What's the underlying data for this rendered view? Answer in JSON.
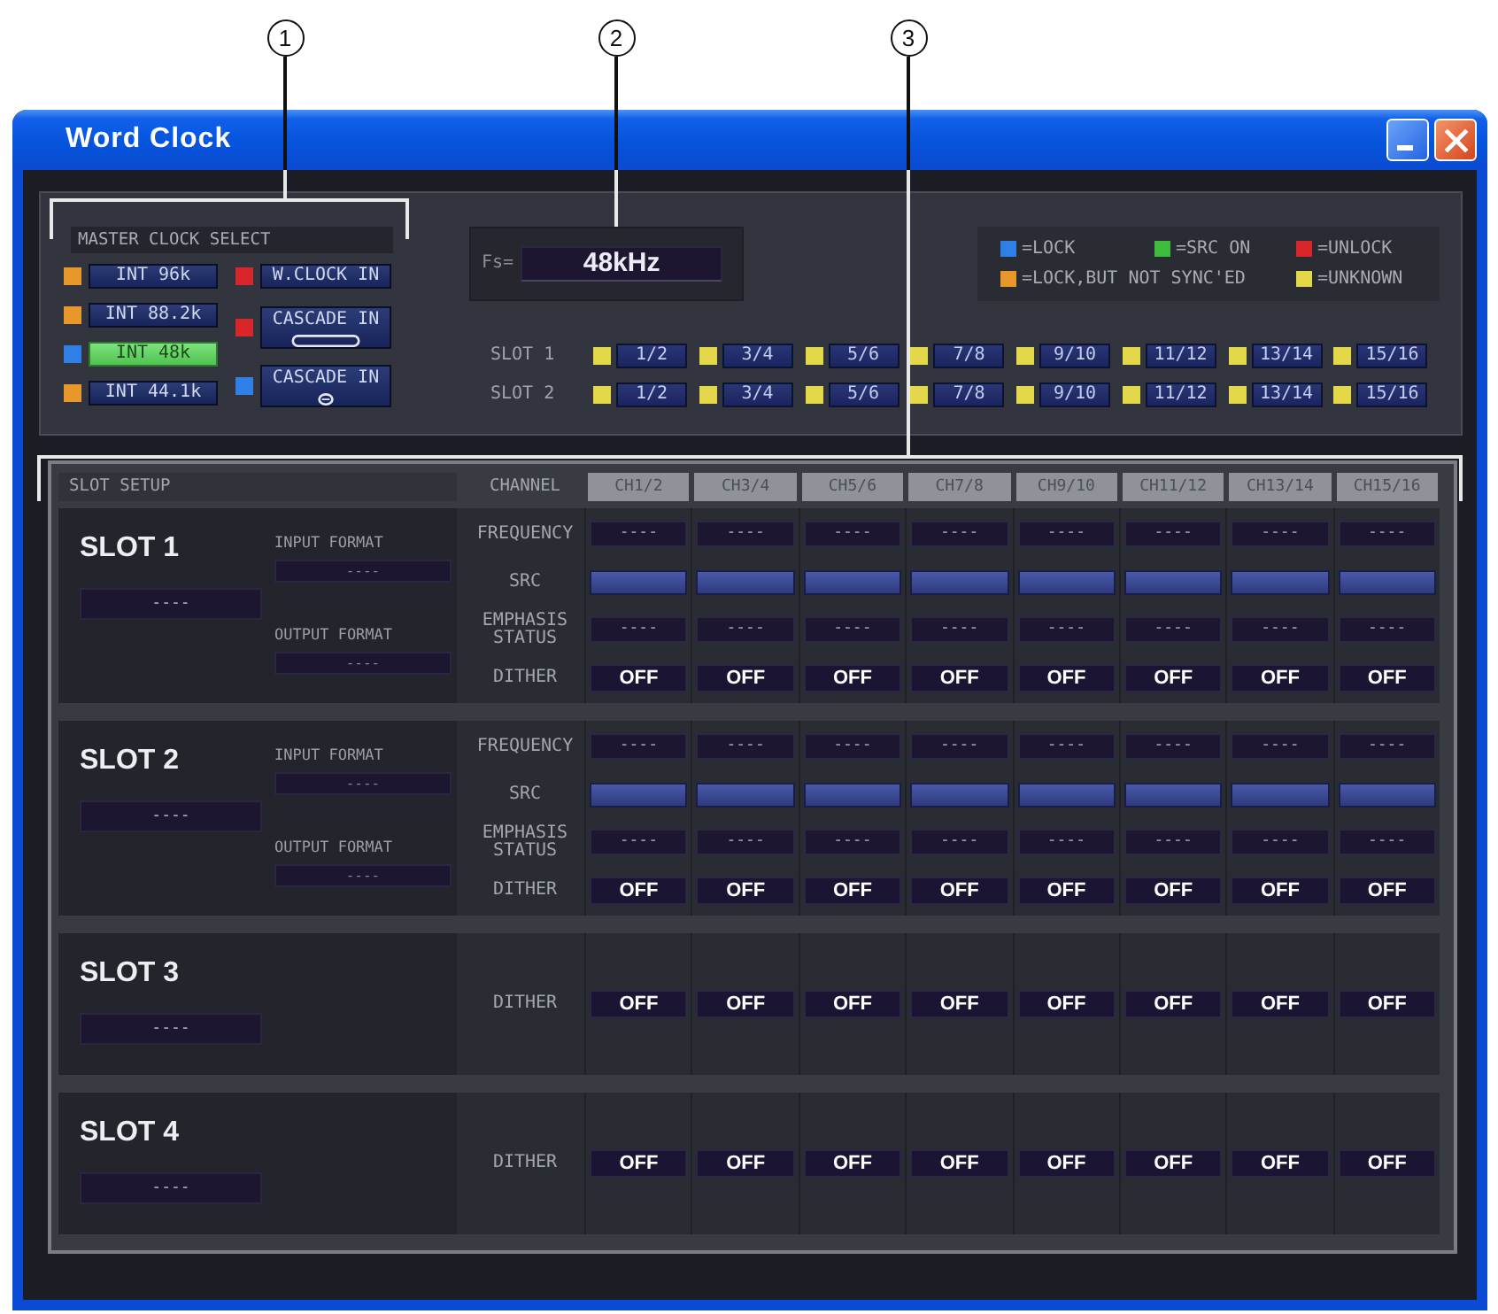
{
  "callouts": [
    {
      "number": "1"
    },
    {
      "number": "2"
    },
    {
      "number": "3"
    }
  ],
  "window": {
    "title": "Word Clock"
  },
  "master_clock_select": {
    "title": "MASTER CLOCK SELECT",
    "internal": [
      {
        "label": "INT 96k",
        "color": "#e8982a",
        "selected": false
      },
      {
        "label": "INT 88.2k",
        "color": "#e8982a",
        "selected": false
      },
      {
        "label": "INT 48k",
        "color": "#2f7fe6",
        "selected": true
      },
      {
        "label": "INT 44.1k",
        "color": "#e8982a",
        "selected": false
      }
    ],
    "external": [
      {
        "label": "W.CLOCK IN",
        "color": "#d8262a",
        "selected": false,
        "kind": "plain"
      },
      {
        "label": "CASCADE IN",
        "color": "#d8262a",
        "selected": false,
        "kind": "oval-connector"
      },
      {
        "label": "CASCADE IN",
        "color": "#2f7fe6",
        "selected": false,
        "kind": "round-connector"
      }
    ]
  },
  "fs": {
    "label": "Fs=",
    "value": "48kHz"
  },
  "legend": [
    {
      "color": "#2f7fe6",
      "label": "=LOCK"
    },
    {
      "color": "#3dbb3d",
      "label": "=SRC ON"
    },
    {
      "color": "#d8262a",
      "label": "=UNLOCK"
    },
    {
      "color": "#e8982a",
      "label": "=LOCK,BUT NOT SYNC'ED"
    },
    {
      "color": "#e2d84a",
      "label": "=UNKNOWN"
    }
  ],
  "slot_status": [
    {
      "label": "SLOT 1",
      "channels": [
        {
          "label": "1/2",
          "color": "#e2d84a"
        },
        {
          "label": "3/4",
          "color": "#e2d84a"
        },
        {
          "label": "5/6",
          "color": "#e2d84a"
        },
        {
          "label": "7/8",
          "color": "#e2d84a"
        },
        {
          "label": "9/10",
          "color": "#e2d84a"
        },
        {
          "label": "11/12",
          "color": "#e2d84a"
        },
        {
          "label": "13/14",
          "color": "#e2d84a"
        },
        {
          "label": "15/16",
          "color": "#e2d84a"
        }
      ]
    },
    {
      "label": "SLOT 2",
      "channels": [
        {
          "label": "1/2",
          "color": "#e2d84a"
        },
        {
          "label": "3/4",
          "color": "#e2d84a"
        },
        {
          "label": "5/6",
          "color": "#e2d84a"
        },
        {
          "label": "7/8",
          "color": "#e2d84a"
        },
        {
          "label": "9/10",
          "color": "#e2d84a"
        },
        {
          "label": "11/12",
          "color": "#e2d84a"
        },
        {
          "label": "13/14",
          "color": "#e2d84a"
        },
        {
          "label": "15/16",
          "color": "#e2d84a"
        }
      ]
    }
  ],
  "slot_setup": {
    "title": "SLOT SETUP",
    "channel_label": "CHANNEL",
    "channels": [
      "CH1/2",
      "CH3/4",
      "CH5/6",
      "CH7/8",
      "CH9/10",
      "CH11/12",
      "CH13/14",
      "CH15/16"
    ],
    "slots": [
      {
        "name": "SLOT 1",
        "card": "----",
        "input_format": {
          "label": "INPUT FORMAT",
          "value": "----"
        },
        "output_format": {
          "label": "OUTPUT FORMAT",
          "value": "----"
        },
        "rows": [
          {
            "label": "FREQUENCY",
            "kind": "readout",
            "cells": [
              "----",
              "----",
              "----",
              "----",
              "----",
              "----",
              "----",
              "----"
            ]
          },
          {
            "label": "SRC",
            "kind": "switch",
            "cells": [
              {
                "on": false
              },
              {
                "on": false
              },
              {
                "on": false
              },
              {
                "on": false
              },
              {
                "on": false
              },
              {
                "on": false
              },
              {
                "on": false
              },
              {
                "on": false
              }
            ]
          },
          {
            "label": "EMPHASIS STATUS",
            "kind": "readout",
            "cells": [
              "----",
              "----",
              "----",
              "----",
              "----",
              "----",
              "----",
              "----"
            ]
          },
          {
            "label": "DITHER",
            "kind": "setting",
            "cells": [
              "OFF",
              "OFF",
              "OFF",
              "OFF",
              "OFF",
              "OFF",
              "OFF",
              "OFF"
            ]
          }
        ]
      },
      {
        "name": "SLOT 2",
        "card": "----",
        "input_format": {
          "label": "INPUT FORMAT",
          "value": "----"
        },
        "output_format": {
          "label": "OUTPUT FORMAT",
          "value": "----"
        },
        "rows": [
          {
            "label": "FREQUENCY",
            "kind": "readout",
            "cells": [
              "----",
              "----",
              "----",
              "----",
              "----",
              "----",
              "----",
              "----"
            ]
          },
          {
            "label": "SRC",
            "kind": "switch",
            "cells": [
              {
                "on": false
              },
              {
                "on": false
              },
              {
                "on": false
              },
              {
                "on": false
              },
              {
                "on": false
              },
              {
                "on": false
              },
              {
                "on": false
              },
              {
                "on": false
              }
            ]
          },
          {
            "label": "EMPHASIS STATUS",
            "kind": "readout",
            "cells": [
              "----",
              "----",
              "----",
              "----",
              "----",
              "----",
              "----",
              "----"
            ]
          },
          {
            "label": "DITHER",
            "kind": "setting",
            "cells": [
              "OFF",
              "OFF",
              "OFF",
              "OFF",
              "OFF",
              "OFF",
              "OFF",
              "OFF"
            ]
          }
        ]
      },
      {
        "name": "SLOT 3",
        "card": "----",
        "rows": [
          {
            "label": "DITHER",
            "kind": "setting",
            "cells": [
              "OFF",
              "OFF",
              "OFF",
              "OFF",
              "OFF",
              "OFF",
              "OFF",
              "OFF"
            ]
          }
        ]
      },
      {
        "name": "SLOT 4",
        "card": "----",
        "rows": [
          {
            "label": "DITHER",
            "kind": "setting",
            "cells": [
              "OFF",
              "OFF",
              "OFF",
              "OFF",
              "OFF",
              "OFF",
              "OFF",
              "OFF"
            ]
          }
        ]
      }
    ]
  }
}
